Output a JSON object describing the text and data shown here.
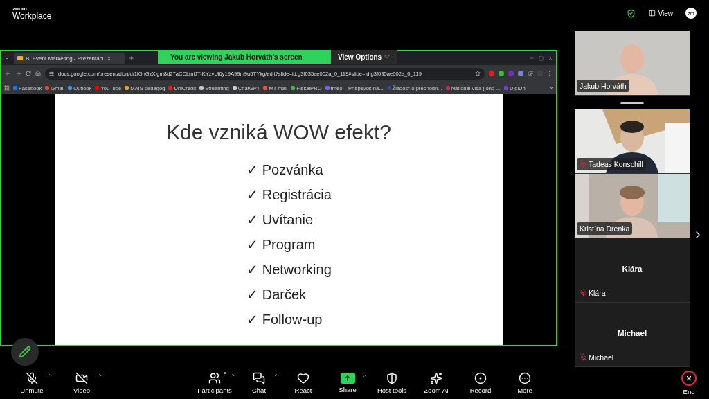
{
  "top_bar": {
    "logo_small": "zoom",
    "logo_large": "Workplace",
    "view_label": "View",
    "avatar": "zm"
  },
  "share_banner": {
    "text": "You are viewing  Jakub Horváth's screen",
    "options": "View Options"
  },
  "browser": {
    "tab_title": "BI Event Marketing - Prezentáci",
    "url": "docs.google.com/presentation/d/1lGhGzXlgm8d27aCCLmiJT-KYzvUl6y19A99m9u5TYkg/edit?slide=id.g3f035ae002a_0_119#slide=id.g3f035ae002a_0_119",
    "bookmarks": [
      {
        "label": "Facebook",
        "color": "#1877f2"
      },
      {
        "label": "Gmail",
        "color": "#ea4335"
      },
      {
        "label": "Outlook",
        "color": "#4a90e2"
      },
      {
        "label": "YouTube",
        "color": "#ff0000"
      },
      {
        "label": "MAIS pedagóg",
        "color": "#f0a030"
      },
      {
        "label": "UniCredit",
        "color": "#e2231a"
      },
      {
        "label": "Streaming",
        "color": "#c8c8c8"
      },
      {
        "label": "ChatGPT",
        "color": "#d0d0d0"
      },
      {
        "label": "MT mail",
        "color": "#e2504a"
      },
      {
        "label": "FiskalPRO",
        "color": "#4caf50"
      },
      {
        "label": "fmeo – Príspevok na...",
        "color": "#7b61ff"
      },
      {
        "label": "Žiadosť o prechodn...",
        "color": "#2b4a8a"
      },
      {
        "label": "National visa (long-...",
        "color": "#c0305a"
      },
      {
        "label": "DigiUni",
        "color": "#7a3fd0"
      }
    ],
    "more": "»"
  },
  "slide": {
    "title": "Kde vzniká WOW efekt?",
    "items": [
      "✓ Pozvánka",
      "✓ Registrácia",
      "✓ Uvítanie",
      "✓ Program",
      "✓ Networking",
      "✓ Darček",
      "✓ Follow-up"
    ]
  },
  "participants": [
    {
      "name": "Jakub Horváth",
      "kind": "video",
      "muted": false
    },
    {
      "name": "Tadeas Konschill",
      "kind": "video",
      "muted": true
    },
    {
      "name": "Kristína Drenka",
      "kind": "video",
      "muted": false
    },
    {
      "name": "Klára",
      "kind": "avatar",
      "muted": true,
      "display_name": "Klára"
    },
    {
      "name": "Michael",
      "kind": "avatar",
      "muted": true,
      "display_name": "Michael"
    }
  ],
  "toolbar": [
    {
      "label": "Unmute",
      "kind": "mic",
      "menu": true
    },
    {
      "label": "Video",
      "kind": "video",
      "menu": true
    },
    {
      "label": "Participants",
      "kind": "participants",
      "menu": true,
      "count": "9"
    },
    {
      "label": "Chat",
      "kind": "chat",
      "menu": true
    },
    {
      "label": "React",
      "kind": "react",
      "menu": false
    },
    {
      "label": "Share",
      "kind": "share",
      "menu": true
    },
    {
      "label": "Host tools",
      "kind": "host",
      "menu": false
    },
    {
      "label": "Zoom AI",
      "kind": "ai",
      "menu": false
    },
    {
      "label": "Record",
      "kind": "record",
      "menu": false
    },
    {
      "label": "More",
      "kind": "more",
      "menu": false
    }
  ],
  "end_button": "End"
}
